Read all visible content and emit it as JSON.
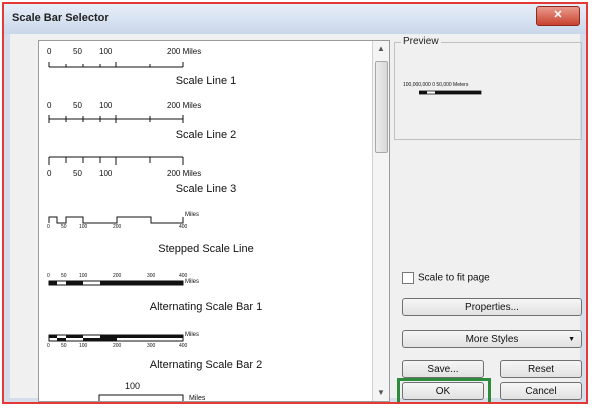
{
  "window": {
    "title": "Scale Bar Selector",
    "close_glyph": "✕"
  },
  "list": {
    "items": [
      {
        "label": "Scale Line 1",
        "ticks": [
          "0",
          "50",
          "100",
          "200 Miles"
        ]
      },
      {
        "label": "Scale Line 2",
        "ticks": [
          "0",
          "50",
          "100",
          "200 Miles"
        ]
      },
      {
        "label": "Scale Line 3",
        "ticks": [
          "0",
          "50",
          "100",
          "200 Miles"
        ]
      },
      {
        "label": "Stepped Scale Line",
        "unit": "Miles",
        "ticks": [
          "0",
          "50",
          "100",
          "200",
          "400"
        ]
      },
      {
        "label": "Alternating Scale Bar 1",
        "unit": "Miles",
        "ticks": [
          "0",
          "50",
          "100",
          "200",
          "300",
          "400"
        ]
      },
      {
        "label": "Alternating Scale Bar 2",
        "unit": "Miles",
        "ticks": [
          "0",
          "50",
          "100",
          "200",
          "300",
          "400"
        ]
      },
      {
        "label": "",
        "ticks": [
          "100"
        ],
        "unit": "Miles"
      }
    ]
  },
  "preview": {
    "title": "Preview",
    "sample_text": "100,000,000 0      50,000 Meters"
  },
  "scale_to_fit": {
    "label": "Scale to fit page",
    "checked": false
  },
  "buttons": {
    "properties": "Properties...",
    "more_styles": "More Styles",
    "save": "Save...",
    "reset": "Reset",
    "ok": "OK",
    "cancel": "Cancel"
  },
  "colors": {
    "highlight_red": "#e53935",
    "highlight_green": "#2e8b3d"
  }
}
